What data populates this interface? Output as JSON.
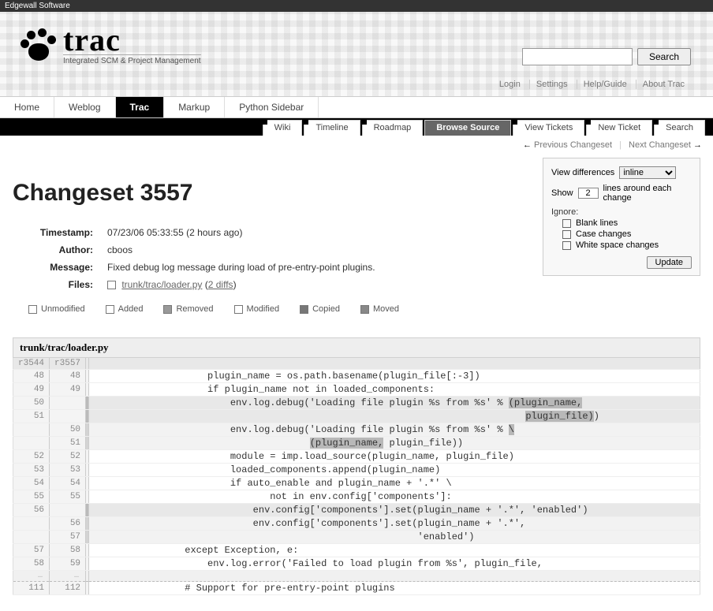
{
  "topbar": {
    "edgewall": "Edgewall Software"
  },
  "logo": {
    "name": "trac",
    "tagline": "Integrated SCM & Project Management"
  },
  "search": {
    "placeholder": "",
    "button": "Search"
  },
  "metanav": {
    "login": "Login",
    "settings": "Settings",
    "help": "Help/Guide",
    "about": "About Trac"
  },
  "tabs": {
    "home": "Home",
    "weblog": "Weblog",
    "trac": "Trac",
    "markup": "Markup",
    "python": "Python Sidebar"
  },
  "subnav": {
    "wiki": "Wiki",
    "timeline": "Timeline",
    "roadmap": "Roadmap",
    "browse": "Browse Source",
    "viewtix": "View Tickets",
    "newtix": "New Ticket",
    "search": "Search"
  },
  "ctx": {
    "prev": "Previous Changeset",
    "next": "Next Changeset"
  },
  "heading": "Changeset 3557",
  "info": {
    "timestamp_label": "Timestamp:",
    "timestamp": "07/23/06 05:33:55 (2 hours ago)",
    "author_label": "Author:",
    "author": "cboos",
    "message_label": "Message:",
    "message": "Fixed debug log message during load of pre-entry-point plugins.",
    "files_label": "Files:",
    "file_path": "trunk/trac/loader.py",
    "diffs_link": "2 diffs"
  },
  "legend": {
    "unmod": "Unmodified",
    "added": "Added",
    "removed": "Removed",
    "modified": "Modified",
    "copied": "Copied",
    "moved": "Moved"
  },
  "prefs": {
    "viewdiff_label": "View differences",
    "viewdiff_value": "inline",
    "show_label": "Show",
    "show_value": "2",
    "show_suffix": "lines around each change",
    "ignore_label": "Ignore:",
    "ig_blank": "Blank lines",
    "ig_case": "Case changes",
    "ig_ws": "White space changes",
    "update": "Update"
  },
  "diff": {
    "file": "trunk/trac/loader.py",
    "rev_old": "r3544",
    "rev_new": "r3557",
    "rows": [
      {
        "t": "ctx",
        "o": "48",
        "n": "48",
        "c": "                    plugin_name = os.path.basename(plugin_file[:-3])"
      },
      {
        "t": "ctx",
        "o": "49",
        "n": "49",
        "c": "                    if plugin_name not in loaded_components:"
      },
      {
        "t": "rem",
        "o": "50",
        "n": "",
        "c": "                        env.log.debug('Loading file plugin %s from %s' % ",
        "hl": "(plugin_name,"
      },
      {
        "t": "rem",
        "o": "51",
        "n": "",
        "c": "                                                                            ",
        "hl": "plugin_file)",
        "tail": ")"
      },
      {
        "t": "add",
        "o": "",
        "n": "50",
        "c": "                        env.log.debug('Loading file plugin %s from %s' % ",
        "hl": "\\"
      },
      {
        "t": "add",
        "o": "",
        "n": "51",
        "c": "                                      ",
        "hl": "(plugin_name,",
        "tail": " plugin_file))"
      },
      {
        "t": "ctx",
        "o": "52",
        "n": "52",
        "c": "                        module = imp.load_source(plugin_name, plugin_file)"
      },
      {
        "t": "ctx",
        "o": "53",
        "n": "53",
        "c": "                        loaded_components.append(plugin_name)"
      },
      {
        "t": "ctx",
        "o": "54",
        "n": "54",
        "c": "                        if auto_enable and plugin_name + '.*' \\"
      },
      {
        "t": "ctx",
        "o": "55",
        "n": "55",
        "c": "                               not in env.config['components']:"
      },
      {
        "t": "rem",
        "o": "56",
        "n": "",
        "c": "                            env.config['components'].set(plugin_name + '.*', 'enabled')"
      },
      {
        "t": "add",
        "o": "",
        "n": "56",
        "c": "                            env.config['components'].set(plugin_name + '.*',"
      },
      {
        "t": "add",
        "o": "",
        "n": "57",
        "c": "                                                         'enabled')"
      },
      {
        "t": "ctx",
        "o": "57",
        "n": "58",
        "c": "                except Exception, e:"
      },
      {
        "t": "ctx",
        "o": "58",
        "n": "59",
        "c": "                    env.log.error('Failed to load plugin from %s', plugin_file,"
      },
      {
        "t": "skip",
        "o": "…",
        "n": "…",
        "c": ""
      },
      {
        "t": "ctx",
        "o": "111",
        "n": "112",
        "c": "                # Support for pre-entry-point plugins"
      }
    ]
  }
}
